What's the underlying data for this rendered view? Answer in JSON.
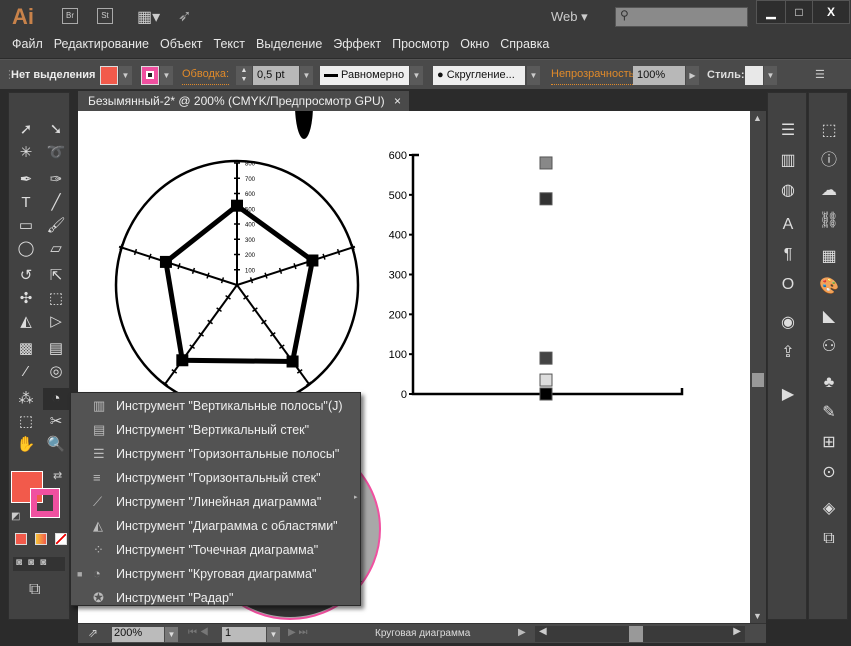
{
  "app": {
    "logo": "Ai",
    "bridge": "Br",
    "stock": "St",
    "workspace": "Web",
    "search_placeholder": "",
    "minimize": "▁",
    "maximize": "□",
    "close": "X"
  },
  "menu": [
    "Файл",
    "Редактирование",
    "Объект",
    "Текст",
    "Выделение",
    "Эффект",
    "Просмотр",
    "Окно",
    "Справка"
  ],
  "control": {
    "selection": "Нет выделения",
    "fill_color": "#f25a4b",
    "stroke_color": "#f050a0",
    "stroke_label": "Обводка:",
    "stroke_weight": "0,5 pt",
    "profile": "Равномерно",
    "brush": "Скругление...",
    "opacity_label": "Непрозрачность:",
    "opacity": "100%",
    "style_label": "Стиль:"
  },
  "document_tab": {
    "title": "Безымянный-2* @ 200% (CMYK/Предпросмотр GPU)",
    "close": "×"
  },
  "tools": [
    "selection-tool",
    "direct-selection-tool",
    "magic-wand-tool",
    "lasso-tool",
    "pen-tool",
    "curvature-tool",
    "type-tool",
    "line-tool",
    "rectangle-tool",
    "paintbrush-tool",
    "shaper-tool",
    "eraser-tool",
    "rotate-tool",
    "scale-tool",
    "puppet-warp-tool",
    "free-transform-tool",
    "shape-builder-tool",
    "perspective-grid-tool",
    "mesh-tool",
    "gradient-tool",
    "eyedropper-tool",
    "blend-tool",
    "symbol-sprayer-tool",
    "pie-graph-tool",
    "artboard-tool",
    "slice-tool",
    "hand-tool",
    "zoom-tool"
  ],
  "flyout": {
    "items": [
      {
        "label": "Инструмент \"Вертикальные полосы\"",
        "shortcut": "(J)",
        "icon": "column-graph-icon",
        "active": false
      },
      {
        "label": "Инструмент \"Вертикальный стек\"",
        "icon": "stacked-column-graph-icon",
        "active": false
      },
      {
        "label": "Инструмент \"Горизонтальные полосы\"",
        "icon": "bar-graph-icon",
        "active": false
      },
      {
        "label": "Инструмент \"Горизонтальный стек\"",
        "icon": "stacked-bar-graph-icon",
        "active": false
      },
      {
        "label": "Инструмент \"Линейная диаграмма\"",
        "icon": "line-graph-icon",
        "active": false
      },
      {
        "label": "Инструмент \"Диаграмма с областями\"",
        "icon": "area-graph-icon",
        "active": false
      },
      {
        "label": "Инструмент \"Точечная диаграмма\"",
        "icon": "scatter-graph-icon",
        "active": false
      },
      {
        "label": "Инструмент \"Круговая диаграмма\"",
        "icon": "pie-graph-icon",
        "active": true
      },
      {
        "label": "Инструмент \"Радар\"",
        "icon": "radar-graph-icon",
        "active": false
      }
    ]
  },
  "status": {
    "zoom": "200%",
    "artboard": "1",
    "tool_name": "Круговая диаграмма"
  },
  "chart_data": [
    {
      "type": "radar",
      "axis_ticks": [
        "100",
        "200",
        "300",
        "400",
        "500",
        "600",
        "700",
        "800"
      ],
      "range": [
        0,
        800
      ],
      "values": [
        520,
        520,
        620,
        610,
        490
      ]
    },
    {
      "type": "scatter",
      "y_ticks": [
        "0",
        "100",
        "200",
        "300",
        "400",
        "500",
        "600"
      ],
      "ylim": [
        0,
        600
      ],
      "points": [
        {
          "y": 580,
          "color": "#888888"
        },
        {
          "y": 490,
          "color": "#333333"
        },
        {
          "y": 90,
          "color": "#444444"
        },
        {
          "y": 35,
          "color": "#dddddd"
        },
        {
          "y": 0,
          "color": "#000000"
        }
      ]
    }
  ],
  "right_panels": {
    "col1": [
      "properties-icon",
      "gradient-icon",
      "transparency-icon",
      "character-icon",
      "paragraph-icon",
      "opentype-icon",
      "image-trace-icon",
      "asset-export-icon",
      "actions-icon"
    ],
    "col2": [
      "transform-icon",
      "info-icon",
      "libraries-icon",
      "links-icon",
      "swatches-icon",
      "color-guide-icon",
      "stroke-icon",
      "graphic-styles-icon",
      "symbols-icon",
      "brushes-icon",
      "align-icon",
      "appearance-icon",
      "layers-icon",
      "artboards-icon"
    ]
  }
}
